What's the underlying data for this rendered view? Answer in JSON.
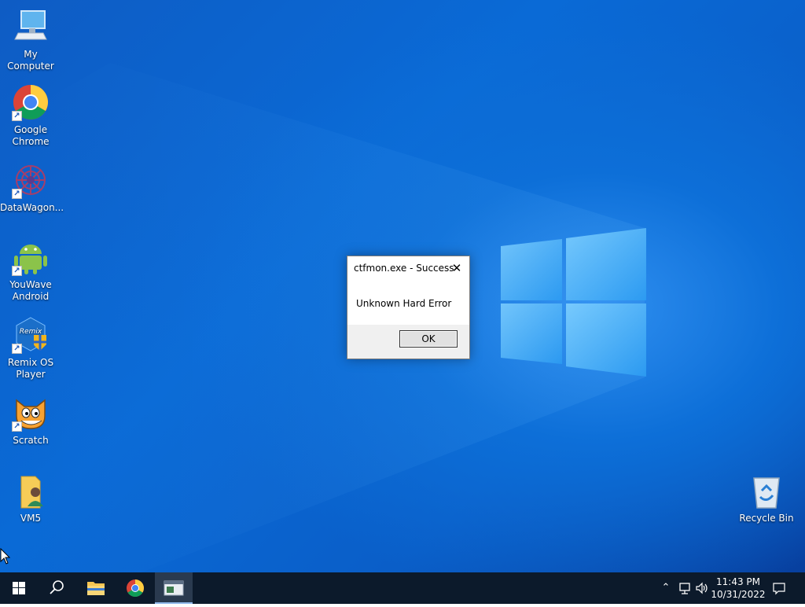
{
  "desktop": {
    "icons": [
      {
        "label": "My Computer",
        "icon": "computer-icon"
      },
      {
        "label": "Google\nChrome",
        "icon": "chrome-icon"
      },
      {
        "label": "DataWagon...",
        "icon": "datawagon-icon"
      },
      {
        "label": "YouWave\nAndroid",
        "icon": "android-icon"
      },
      {
        "label": "Remix OS\nPlayer",
        "icon": "remix-os-icon"
      },
      {
        "label": "Scratch",
        "icon": "scratch-icon"
      },
      {
        "label": "VM5",
        "icon": "user-folder-icon"
      },
      {
        "label": "Recycle Bin",
        "icon": "recycle-bin-icon"
      }
    ]
  },
  "dialog": {
    "title": "ctfmon.exe - Success",
    "message": "Unknown Hard Error",
    "ok_label": "OK"
  },
  "taskbar": {
    "time": "11:43 PM",
    "date": "10/31/2022"
  },
  "colors": {
    "desktop_blue": "#0a6ad6",
    "taskbar": "#0c1a2b"
  }
}
